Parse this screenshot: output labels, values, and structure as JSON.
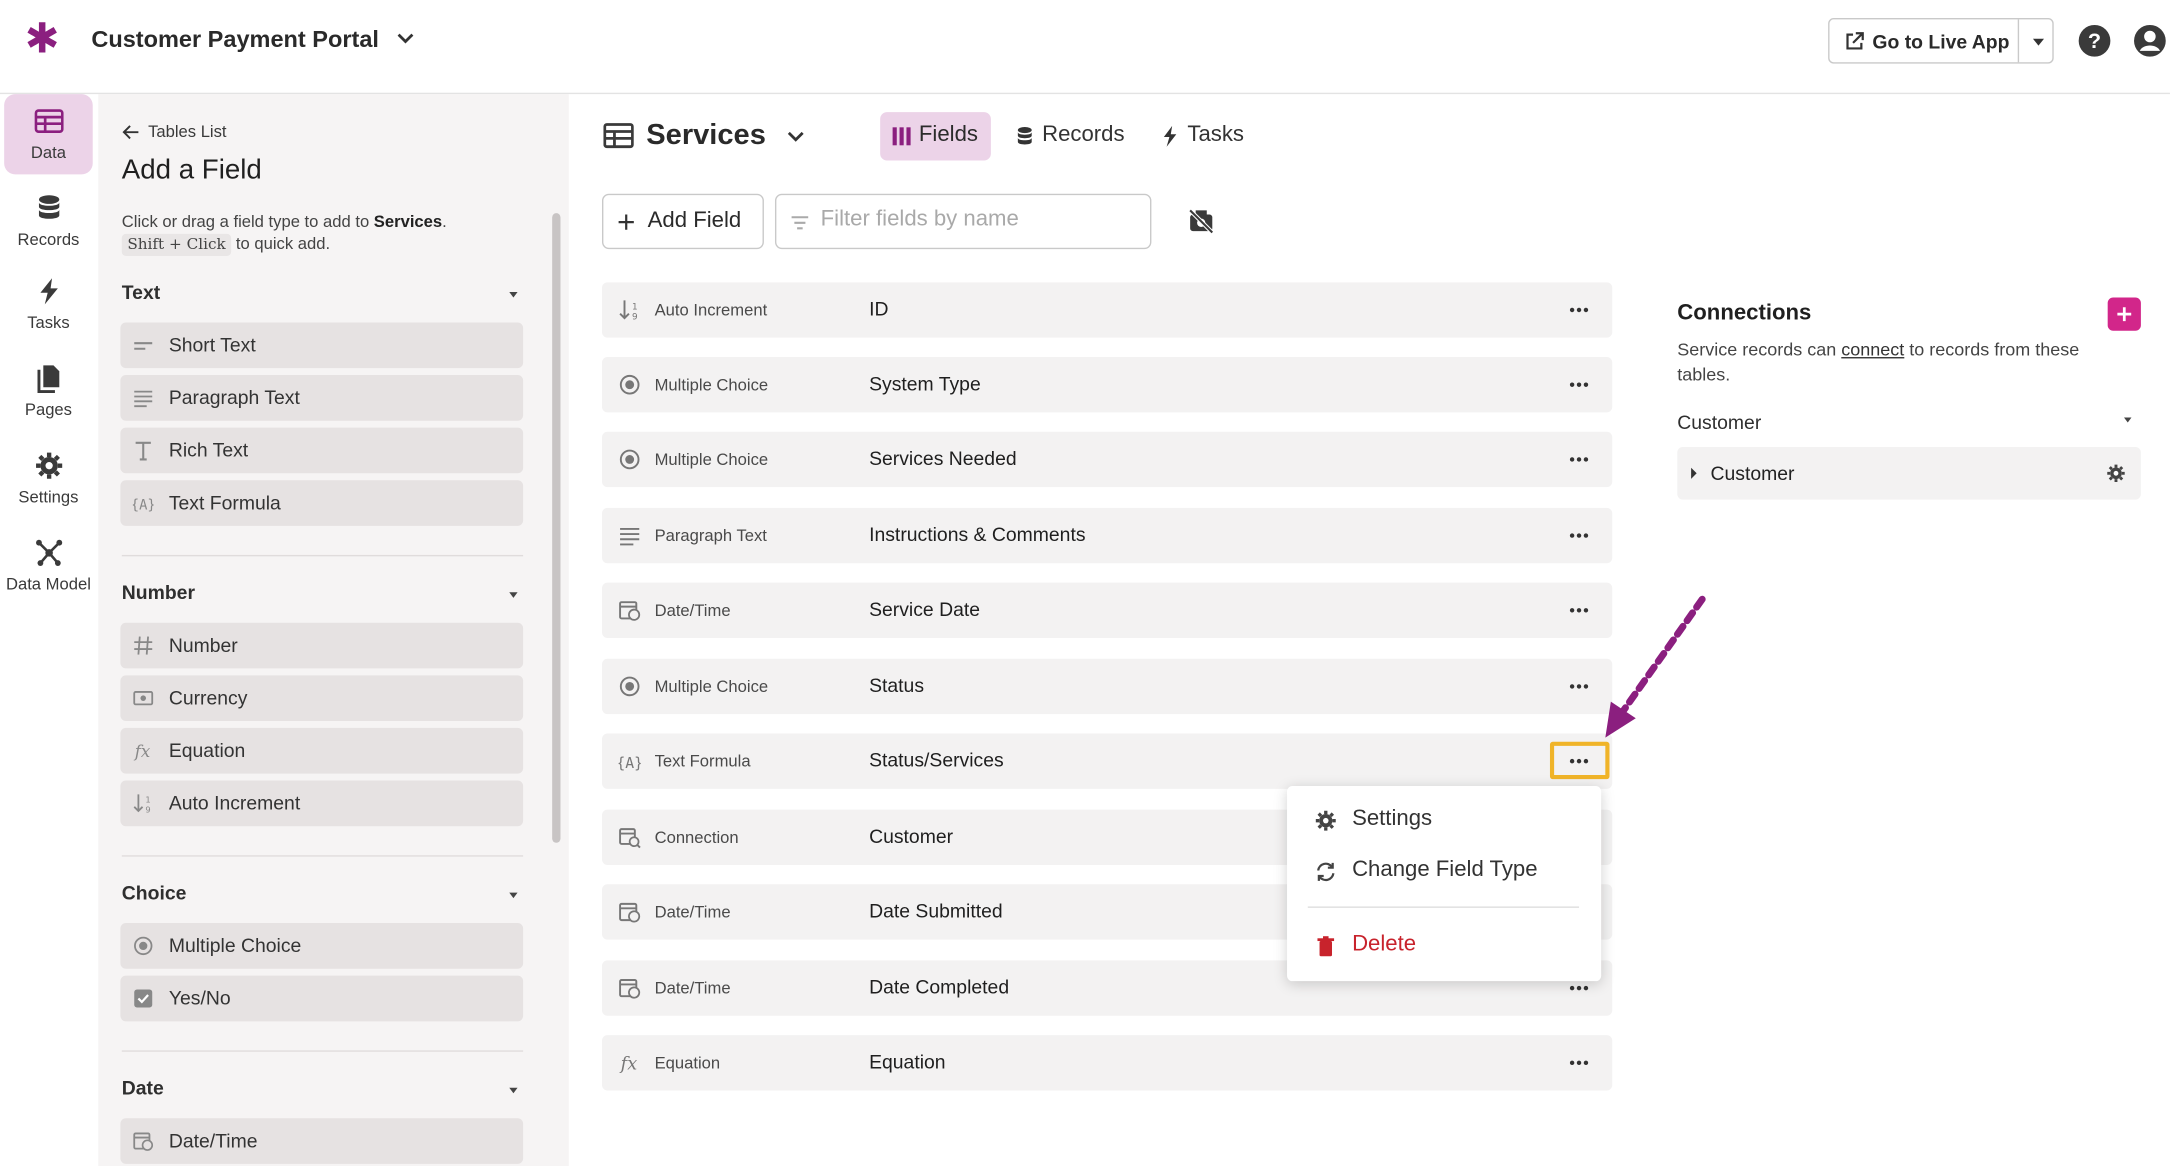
{
  "header": {
    "app_title": "Customer Payment Portal",
    "live_app_label": "Go to Live App"
  },
  "rail": [
    {
      "label": "Data",
      "icon": "table-icon",
      "active": true
    },
    {
      "label": "Records",
      "icon": "database-icon"
    },
    {
      "label": "Tasks",
      "icon": "bolt-icon"
    },
    {
      "label": "Pages",
      "icon": "pages-icon"
    },
    {
      "label": "Settings",
      "icon": "gear-icon"
    },
    {
      "label": "Data Model",
      "icon": "network-icon"
    }
  ],
  "panel": {
    "back_label": "Tables List",
    "title": "Add a Field",
    "desc_pre": "Click or drag a field type to add to ",
    "desc_table": "Services",
    "desc_post": ".",
    "shortcut": "Shift + Click",
    "shortcut_post": " to quick add.",
    "sections": [
      {
        "title": "Text",
        "items": [
          "Short Text",
          "Paragraph Text",
          "Rich Text",
          "Text Formula"
        ]
      },
      {
        "title": "Number",
        "items": [
          "Number",
          "Currency",
          "Equation",
          "Auto Increment"
        ]
      },
      {
        "title": "Choice",
        "items": [
          "Multiple Choice",
          "Yes/No"
        ]
      },
      {
        "title": "Date",
        "items": [
          "Date/Time"
        ]
      }
    ]
  },
  "main": {
    "table_name": "Services",
    "tabs": [
      {
        "label": "Fields",
        "active": true
      },
      {
        "label": "Records"
      },
      {
        "label": "Tasks"
      }
    ],
    "add_field_label": "Add Field",
    "filter_placeholder": "Filter fields by name",
    "fields": [
      {
        "type": "Auto Increment",
        "name": "ID"
      },
      {
        "type": "Multiple Choice",
        "name": "System Type"
      },
      {
        "type": "Multiple Choice",
        "name": "Services Needed"
      },
      {
        "type": "Paragraph Text",
        "name": "Instructions & Comments"
      },
      {
        "type": "Date/Time",
        "name": "Service Date"
      },
      {
        "type": "Multiple Choice",
        "name": "Status"
      },
      {
        "type": "Text Formula",
        "name": "Status/Services"
      },
      {
        "type": "Connection",
        "name": "Customer"
      },
      {
        "type": "Date/Time",
        "name": "Date Submitted"
      },
      {
        "type": "Date/Time",
        "name": "Date Completed"
      },
      {
        "type": "Equation",
        "name": "Equation"
      }
    ]
  },
  "context_menu": {
    "settings": "Settings",
    "change_type": "Change Field Type",
    "delete": "Delete"
  },
  "connections": {
    "title": "Connections",
    "desc_pre": "Service records can ",
    "desc_link": "connect",
    "desc_post": " to records from these tables.",
    "group": "Customer",
    "item": "Customer"
  },
  "colors": {
    "brand": "#8b1f7f",
    "accent_bg": "#ecd3e8",
    "add_button": "#d2268a",
    "danger": "#c8232c",
    "highlight": "#f0b429",
    "arrow": "#8b1f7f"
  }
}
